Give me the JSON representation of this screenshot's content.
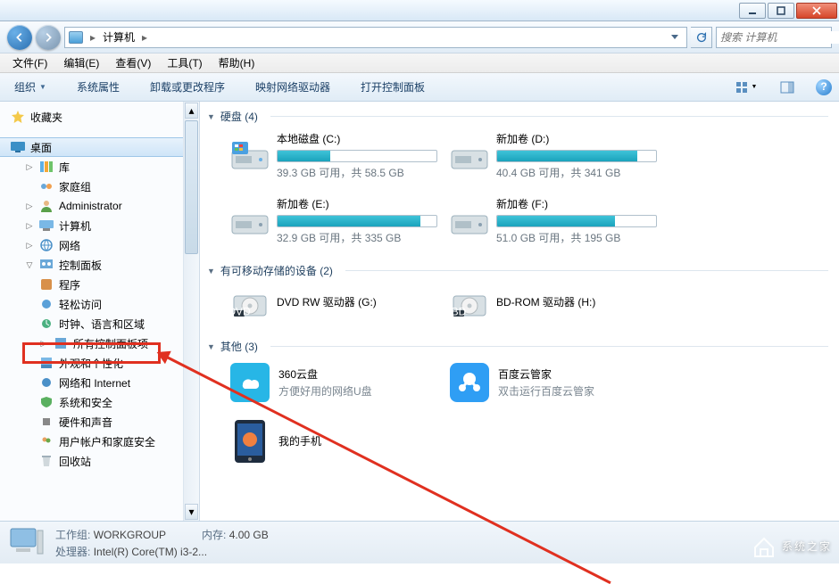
{
  "address": {
    "root": "计算机",
    "sep": "▶"
  },
  "search": {
    "placeholder": "搜索 计算机"
  },
  "menus": [
    "文件(F)",
    "编辑(E)",
    "查看(V)",
    "工具(T)",
    "帮助(H)"
  ],
  "toolbar": {
    "organize": "组织",
    "sysprops": "系统属性",
    "uninstall": "卸载或更改程序",
    "mapdrive": "映射网络驱动器",
    "opencpl": "打开控制面板"
  },
  "tree": {
    "favorites": "收藏夹",
    "desktop": "桌面",
    "libraries": "库",
    "homegroup": "家庭组",
    "administrator": "Administrator",
    "computer": "计算机",
    "network": "网络",
    "controlpanel": "控制面板",
    "programs": "程序",
    "easyaccess": "轻松访问",
    "clockregion": "时钟、语言和区域",
    "allitems": "所有控制面板项",
    "appearance": "外观和个性化",
    "netinternet": "网络和 Internet",
    "system": "系统和安全",
    "hardware": "硬件和声音",
    "useraccounts": "用户帐户和家庭安全",
    "recycle": "回收站"
  },
  "groups": {
    "hdd": {
      "title": "硬盘 (4)"
    },
    "removable": {
      "title": "有可移动存储的设备 (2)"
    },
    "other": {
      "title": "其他 (3)"
    }
  },
  "drives": [
    {
      "name": "本地磁盘 (C:)",
      "stats": "39.3 GB 可用，共 58.5 GB",
      "pct": 33
    },
    {
      "name": "新加卷 (D:)",
      "stats": "40.4 GB 可用，共 341 GB",
      "pct": 88
    },
    {
      "name": "新加卷 (E:)",
      "stats": "32.9 GB 可用，共 335 GB",
      "pct": 90
    },
    {
      "name": "新加卷 (F:)",
      "stats": "51.0 GB 可用，共 195 GB",
      "pct": 74
    }
  ],
  "optical": [
    {
      "name": "DVD RW 驱动器 (G:)",
      "tag": "DVD"
    },
    {
      "name": "BD-ROM 驱动器 (H:)",
      "tag": "BD"
    }
  ],
  "apps": [
    {
      "name": "360云盘",
      "desc": "方便好用的网络U盘",
      "color": "#27b6e6"
    },
    {
      "name": "百度云管家",
      "desc": "双击运行百度云管家",
      "color": "#2f9ef4"
    },
    {
      "name": "我的手机",
      "desc": "",
      "color": "#2a5d9e"
    }
  ],
  "details": {
    "workgroup_k": "工作组:",
    "workgroup_v": "WORKGROUP",
    "mem_k": "内存:",
    "mem_v": "4.00 GB",
    "cpu_k": "处理器:",
    "cpu_v": "Intel(R) Core(TM) i3-2..."
  },
  "watermark": "系统之家"
}
